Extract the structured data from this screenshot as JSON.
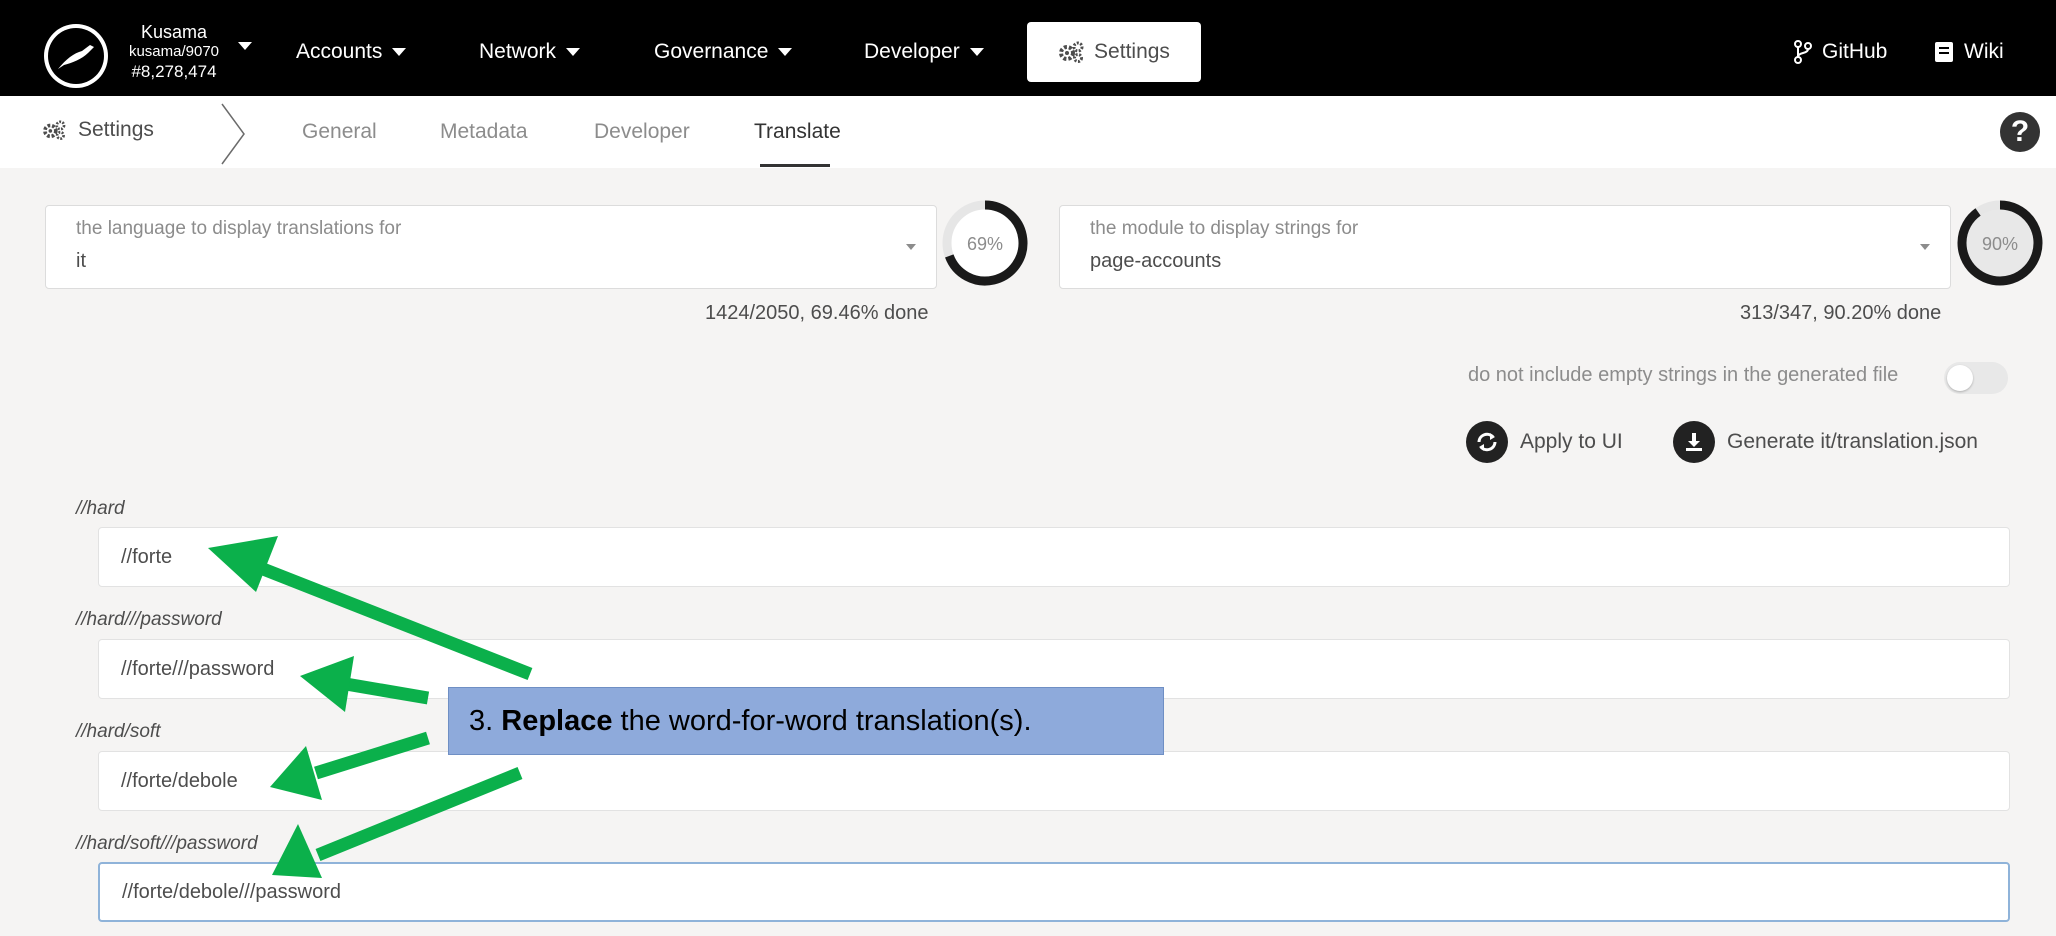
{
  "topbar": {
    "chain_name": "Kusama",
    "chain_spec": "kusama/9070",
    "block": "#8,278,474",
    "nav": [
      "Accounts",
      "Network",
      "Governance",
      "Developer"
    ],
    "settings_label": "Settings",
    "github_label": "GitHub",
    "wiki_label": "Wiki"
  },
  "subbar": {
    "title": "Settings",
    "tabs": [
      "General",
      "Metadata",
      "Developer",
      "Translate"
    ],
    "active_tab": "Translate",
    "help": "?"
  },
  "language": {
    "label": "the language to display translations for",
    "value": "it",
    "percent_label": "69%",
    "percent": 0.6946,
    "done": "1424/2050, 69.46% done"
  },
  "module": {
    "label": "the module to display strings for",
    "value": "page-accounts",
    "percent_label": "90%",
    "percent": 0.902,
    "done": "313/347, 90.20% done"
  },
  "toggle": {
    "label": "do not include empty strings in the generated file",
    "on": false
  },
  "actions": {
    "apply": "Apply to UI",
    "generate": "Generate it/translation.json"
  },
  "strings": [
    {
      "key": "//hard",
      "value": "//forte"
    },
    {
      "key": "//hard///password",
      "value": "//forte///password"
    },
    {
      "key": "//hard/soft",
      "value": "//forte/debole"
    },
    {
      "key": "//hard/soft///password",
      "value": "//forte/debole///password"
    }
  ],
  "annotation": {
    "prefix": "3. ",
    "bold": "Replace",
    "rest": " the word-for-word translation(s).",
    "color": "#8eaadb",
    "arrow_color": "#0bb04b"
  },
  "colors": {
    "topbar": "#000000",
    "ring": "#1a1a1a"
  }
}
